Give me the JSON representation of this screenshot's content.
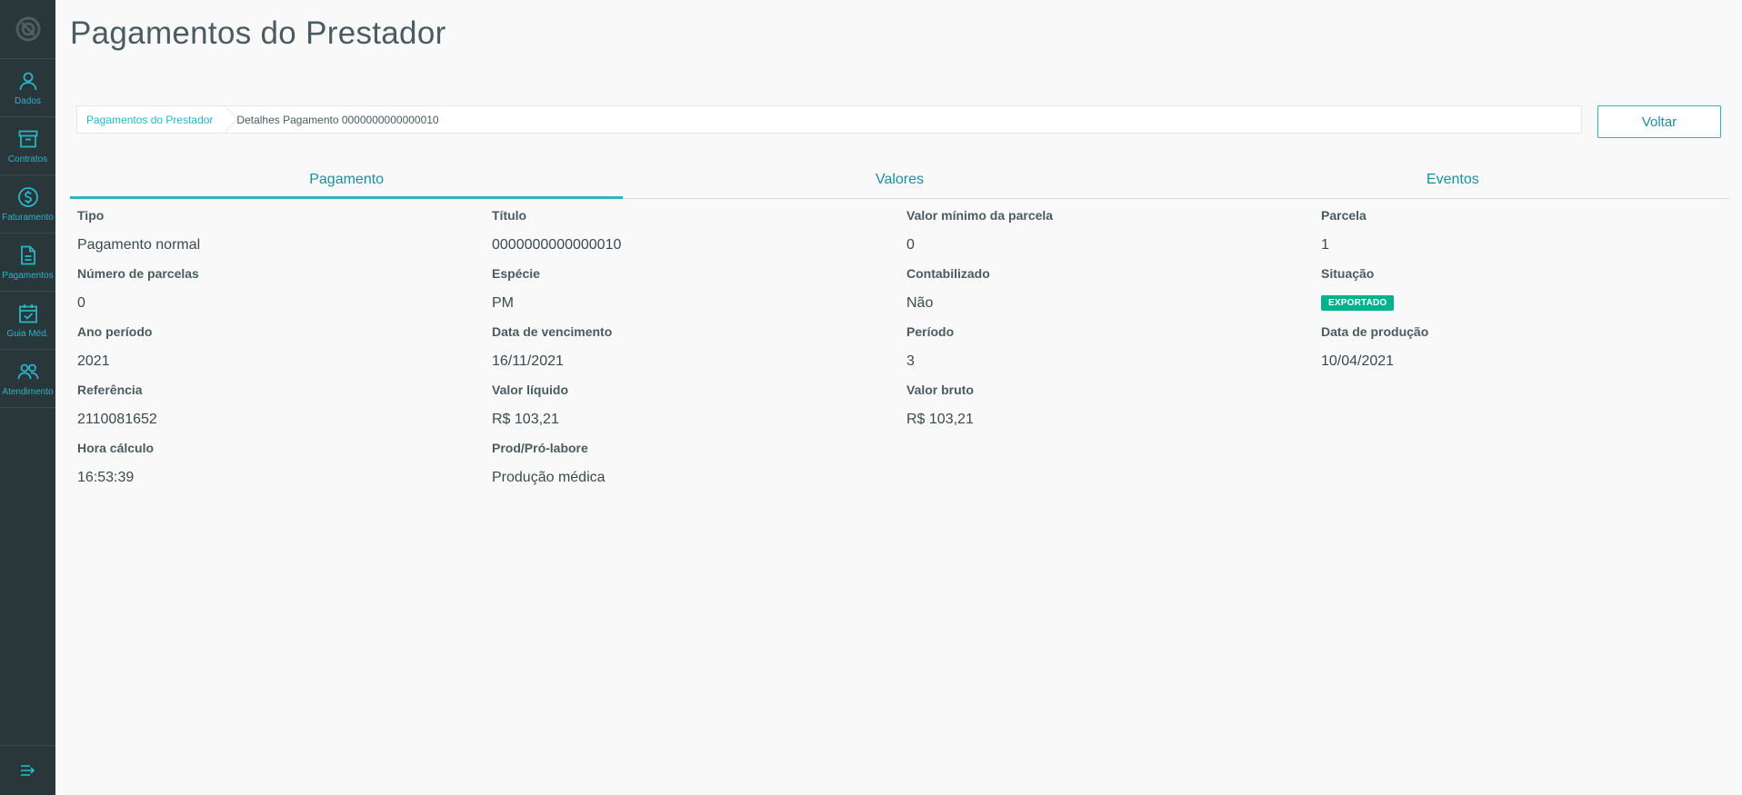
{
  "page": {
    "title": "Pagamentos do Prestador"
  },
  "sidebar": {
    "items": [
      {
        "label": "Dados",
        "icon": "user-icon"
      },
      {
        "label": "Contratos",
        "icon": "archive-icon"
      },
      {
        "label": "Faturamento",
        "icon": "dollar-icon"
      },
      {
        "label": "Pagamentos",
        "icon": "document-icon"
      },
      {
        "label": "Guia Méd.",
        "icon": "calendar-check-icon"
      },
      {
        "label": "Atendimento",
        "icon": "users-icon"
      }
    ]
  },
  "breadcrumb": {
    "link": "Pagamentos do Prestador",
    "current": "Detalhes Pagamento 0000000000000010"
  },
  "actions": {
    "back": "Voltar"
  },
  "tabs": [
    "Pagamento",
    "Valores",
    "Eventos"
  ],
  "fields": {
    "tipo": {
      "label": "Tipo",
      "value": "Pagamento normal"
    },
    "titulo": {
      "label": "Título",
      "value": "0000000000000010"
    },
    "valor_minimo": {
      "label": "Valor mínimo da parcela",
      "value": "0"
    },
    "parcela": {
      "label": "Parcela",
      "value": "1"
    },
    "num_parcelas": {
      "label": "Número de parcelas",
      "value": "0"
    },
    "especie": {
      "label": "Espécie",
      "value": "PM"
    },
    "contabilizado": {
      "label": "Contabilizado",
      "value": "Não"
    },
    "situacao": {
      "label": "Situação",
      "value": "EXPORTADO"
    },
    "ano_periodo": {
      "label": "Ano período",
      "value": "2021"
    },
    "data_vencimento": {
      "label": "Data de vencimento",
      "value": "16/11/2021"
    },
    "periodo": {
      "label": "Período",
      "value": "3"
    },
    "data_producao": {
      "label": "Data de produção",
      "value": "10/04/2021"
    },
    "referencia": {
      "label": "Referência",
      "value": "2110081652"
    },
    "valor_liquido": {
      "label": "Valor líquido",
      "value": "R$ 103,21"
    },
    "valor_bruto": {
      "label": "Valor bruto",
      "value": "R$ 103,21"
    },
    "hora_calculo": {
      "label": "Hora cálculo",
      "value": "16:53:39"
    },
    "prod_pro_labore": {
      "label": "Prod/Pró-labore",
      "value": "Produção médica"
    }
  },
  "colors": {
    "sidebar": "#29363a",
    "accent": "#29b6c5",
    "badge": "#00b28e"
  }
}
